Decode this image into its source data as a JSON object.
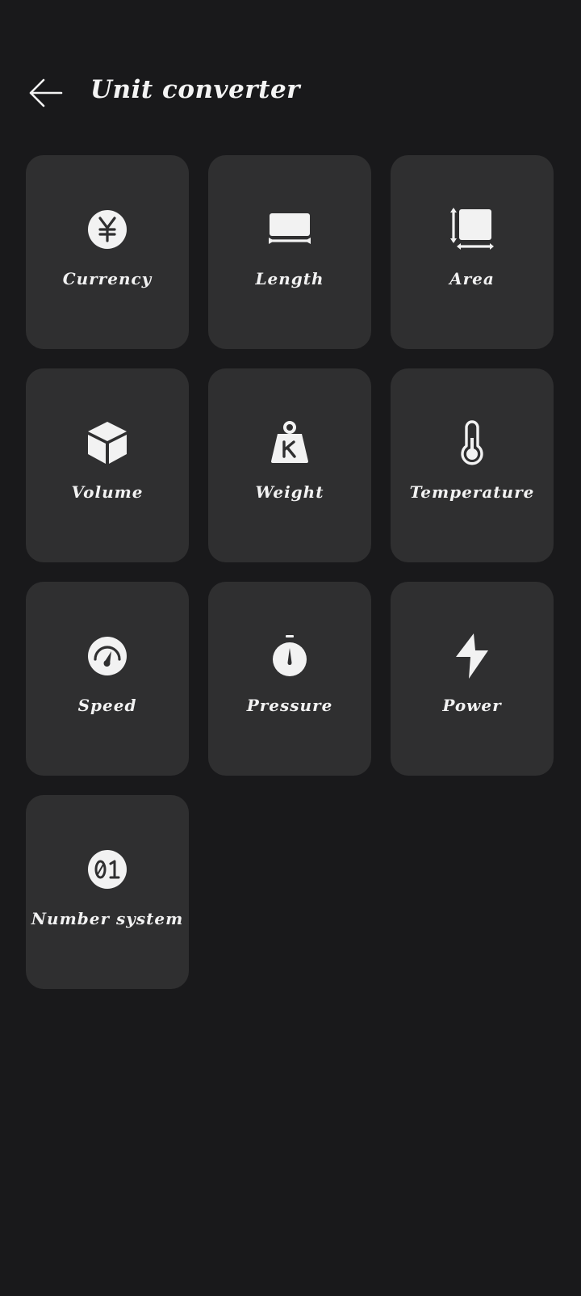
{
  "header": {
    "title": "Unit converter"
  },
  "tiles": [
    {
      "label": "Currency",
      "icon": "yen-coin-icon"
    },
    {
      "label": "Length",
      "icon": "ruler-icon"
    },
    {
      "label": "Area",
      "icon": "area-square-icon"
    },
    {
      "label": "Volume",
      "icon": "cube-icon"
    },
    {
      "label": "Weight",
      "icon": "kettlebell-icon"
    },
    {
      "label": "Temperature",
      "icon": "thermometer-icon"
    },
    {
      "label": "Speed",
      "icon": "speedometer-icon"
    },
    {
      "label": "Pressure",
      "icon": "stopwatch-gauge-icon"
    },
    {
      "label": "Power",
      "icon": "lightning-bolt-icon"
    },
    {
      "label": "Number system",
      "icon": "binary-01-icon"
    }
  ],
  "colors": {
    "background": "#19191b",
    "tile": "#2f2f30",
    "icon": "#f2f2f2",
    "text": "#f2f2f2"
  }
}
